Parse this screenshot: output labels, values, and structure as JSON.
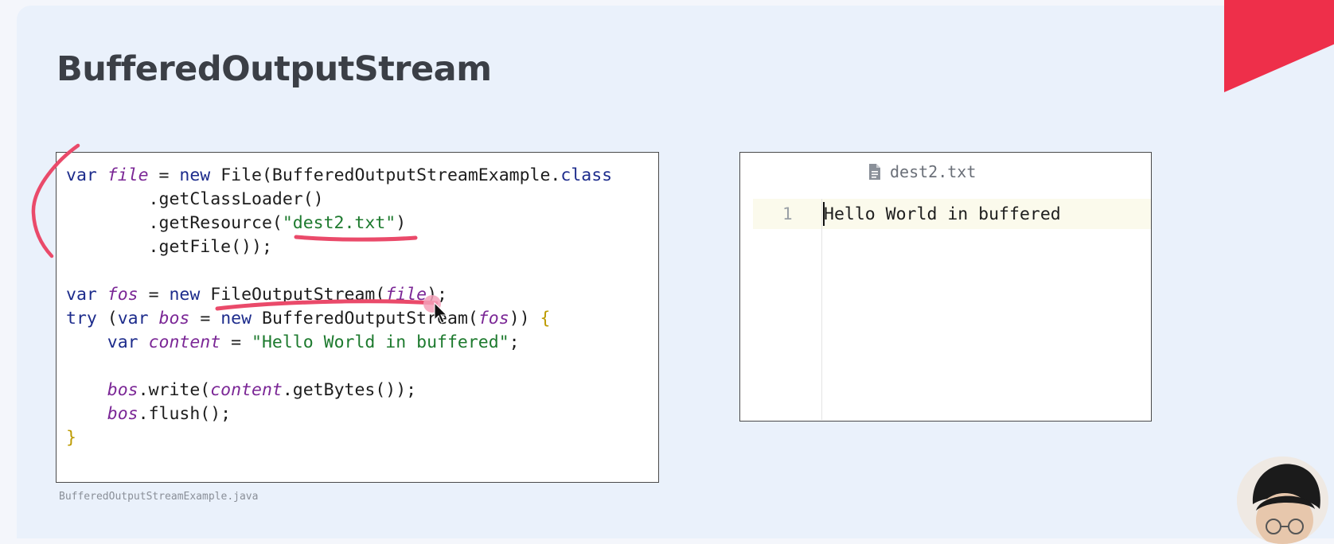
{
  "slide": {
    "title": "BufferedOutputStream",
    "accent_color": "#ee2f4a",
    "background_color": "#eaf1fb"
  },
  "code_panel": {
    "language": "java",
    "file_caption": "BufferedOutputStreamExample.java",
    "lines": [
      "var file = new File(BufferedOutputStreamExample.class",
      "        .getClassLoader()",
      "        .getResource(\"dest2.txt\")",
      "        .getFile());",
      "",
      "var fos = new FileOutputStream(file);",
      "try (var bos = new BufferedOutputStream(fos)) {",
      "    var content = \"Hello World in buffered\";",
      "",
      "    bos.write(content.getBytes());",
      "    bos.flush();",
      "}"
    ],
    "colors": {
      "keyword": "#1d2c8c",
      "variable": "#7b2796",
      "string": "#1d7a2e",
      "brace": "#bd9b00"
    }
  },
  "file_panel": {
    "filename": "dest2.txt",
    "icon": "file-icon",
    "lines": [
      {
        "number": "1",
        "text": "Hello World in buffered"
      }
    ]
  },
  "annotations": {
    "ink_color": "#ea4a6a",
    "marks": [
      "bracket-stroke",
      "underline-dest2",
      "underline-fileoutputstream"
    ]
  },
  "webcam": {
    "icon": "presenter-webcam"
  }
}
